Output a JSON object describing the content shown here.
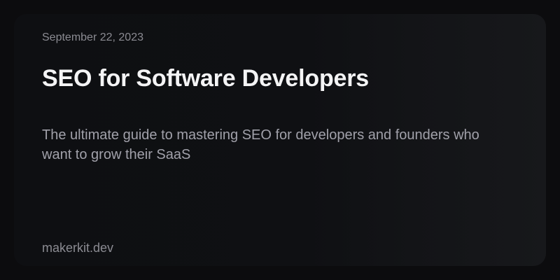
{
  "card": {
    "date": "September 22, 2023",
    "title": "SEO for Software Developers",
    "subtitle": "The ultimate guide to mastering SEO for developers and founders who want to grow their SaaS",
    "site": "makerkit.dev"
  },
  "colors": {
    "background": "#0c0c0e",
    "card": "#0f1013",
    "title": "#f4f4f5",
    "muted": "#8b8b92",
    "subtitle": "#a1a1aa"
  }
}
